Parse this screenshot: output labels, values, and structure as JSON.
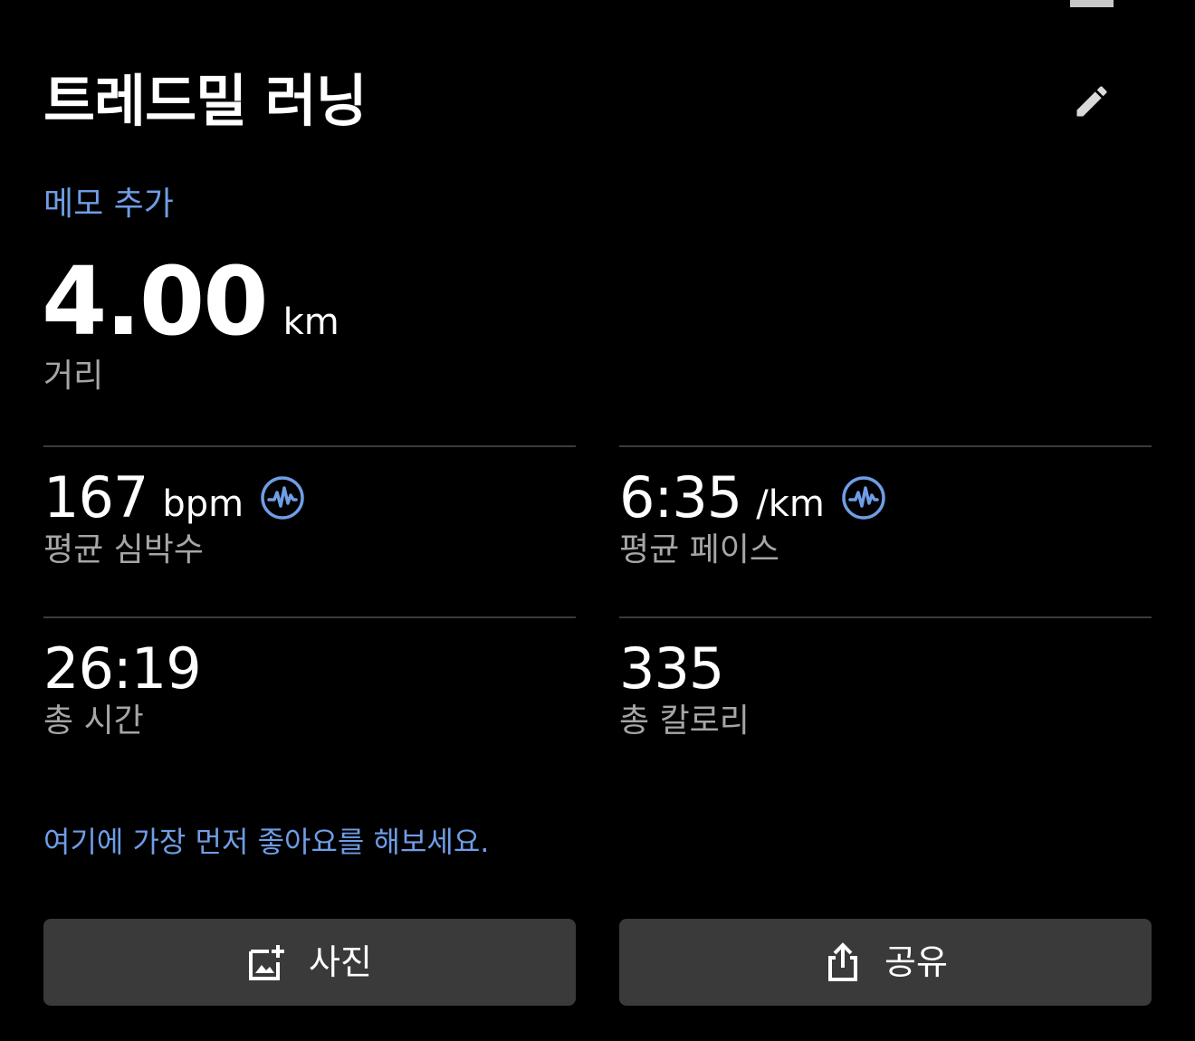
{
  "workout": {
    "title": "트레드밀 러닝",
    "memo_link": "메모 추가"
  },
  "distance": {
    "value": "4.00",
    "unit": "km",
    "label": "거리"
  },
  "stats": {
    "heart_rate": {
      "value": "167",
      "unit": "bpm",
      "label": "평균 심박수",
      "icon": "activity-info-icon"
    },
    "pace": {
      "value": "6:35",
      "unit": "/km",
      "label": "평균 페이스",
      "icon": "activity-info-icon"
    },
    "total_time": {
      "value": "26:19",
      "label": "총 시간"
    },
    "calories": {
      "value": "335",
      "label": "총 칼로리"
    }
  },
  "social": {
    "like_prompt": "여기에 가장 먼저 좋아요를 해보세요."
  },
  "actions": {
    "photo_label": "사진",
    "photo_icon": "add-photo-icon",
    "share_label": "공유",
    "share_icon": "share-icon"
  },
  "theme": {
    "background": "#000000",
    "accent": "#6f9de6",
    "secondary_text": "#a6a6a6",
    "button_bg": "#3a3a3a"
  }
}
